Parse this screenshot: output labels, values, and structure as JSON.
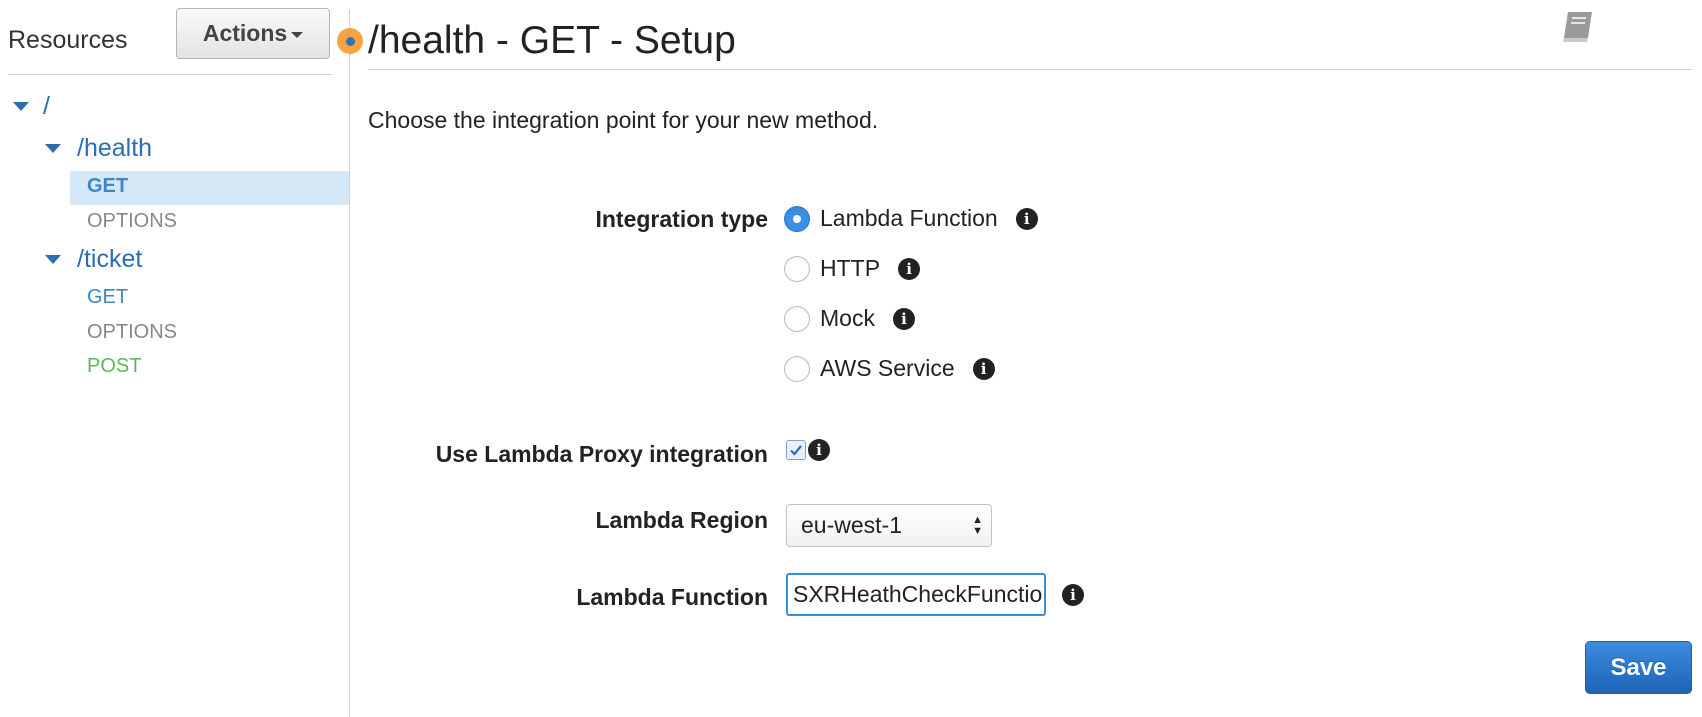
{
  "sidebar": {
    "title": "Resources",
    "actions_label": "Actions",
    "tree": [
      {
        "path": "/",
        "methods": []
      },
      {
        "path": "/health",
        "methods": [
          "GET",
          "OPTIONS"
        ]
      },
      {
        "path": "/ticket",
        "methods": [
          "GET",
          "OPTIONS",
          "POST"
        ]
      }
    ],
    "selected": "/health GET"
  },
  "main": {
    "title": "/health - GET - Setup",
    "intro": "Choose the integration point for your new method.",
    "integration_type": {
      "label": "Integration type",
      "options": [
        "Lambda Function",
        "HTTP",
        "Mock",
        "AWS Service"
      ],
      "selected": "Lambda Function"
    },
    "proxy": {
      "label": "Use Lambda Proxy integration",
      "checked": true
    },
    "region": {
      "label": "Lambda Region",
      "value": "eu-west-1"
    },
    "function": {
      "label": "Lambda Function",
      "value": "SXRHeathCheckFunctio"
    },
    "save_label": "Save"
  },
  "icons": {
    "info": "info-icon",
    "book": "book-icon",
    "tree_toggle": "triangle-down-icon"
  },
  "colors": {
    "link_blue": "#2a6db5",
    "post_green": "#5cb85c",
    "save_blue": "#1d63b6",
    "orange": "#f6a440"
  }
}
